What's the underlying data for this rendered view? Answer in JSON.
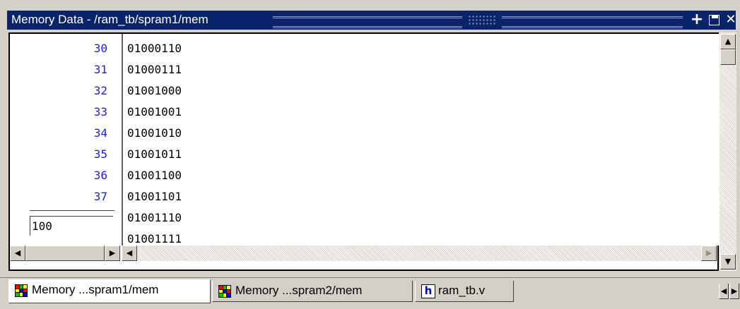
{
  "window": {
    "title": "Memory Data - /ram_tb/spram1/mem",
    "buttons": {
      "add": "+",
      "undock": "",
      "close": "✕"
    }
  },
  "memory": {
    "addresses": [
      "30",
      "31",
      "32",
      "33",
      "34",
      "35",
      "36",
      "37"
    ],
    "values": [
      "01000110",
      "01000111",
      "01001000",
      "01001001",
      "01001010",
      "01001011",
      "01001100",
      "01001101",
      "01001110",
      "01001111"
    ],
    "goto_address": "100"
  },
  "scrollbars": {
    "up_arrow": "▲",
    "down_arrow": "▼",
    "left_arrow": "◀",
    "right_arrow": "▶"
  },
  "tabs": [
    {
      "label": "Memory ...spram1/mem",
      "icon": "memory-grid-icon",
      "active": true
    },
    {
      "label": "Memory ...spram2/mem",
      "icon": "memory-grid-icon",
      "active": false
    },
    {
      "label": "ram_tb.v",
      "icon": "verilog-file-icon",
      "icon_glyph": "h",
      "active": false
    }
  ],
  "tab_nav": {
    "left": "◀",
    "right": "▶"
  },
  "colors": {
    "titlebar": "#0a246a",
    "address_text": "#2020e0",
    "face": "#d4d0c8"
  }
}
